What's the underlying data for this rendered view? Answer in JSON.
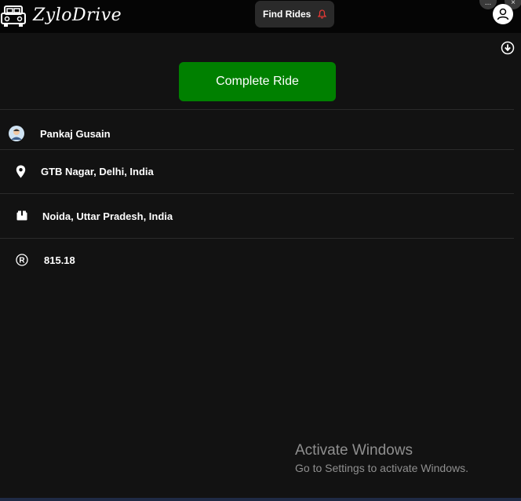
{
  "header": {
    "brand": "ZyloDrive",
    "find_rides_label": "Find Rides",
    "window_controls": [
      "...",
      "×"
    ]
  },
  "actions": {
    "complete_ride_label": "Complete Ride"
  },
  "ride": {
    "passenger": "Pankaj Gusain",
    "pickup": "GTB Nagar, Delhi, India",
    "drop": "Noida, Uttar Pradesh, India",
    "fare": "815.18"
  },
  "watermark": {
    "title": "Activate Windows",
    "subtitle": "Go to Settings to activate Windows."
  },
  "colors": {
    "background": "#121212",
    "topbar": "#050505",
    "accent_green": "#008000",
    "bell_red": "#e53935"
  },
  "icons": [
    "car-logo-icon",
    "bell-icon",
    "user-icon",
    "download-icon",
    "passenger-avatar-icon",
    "location-pin-icon",
    "package-icon",
    "registered-icon"
  ]
}
